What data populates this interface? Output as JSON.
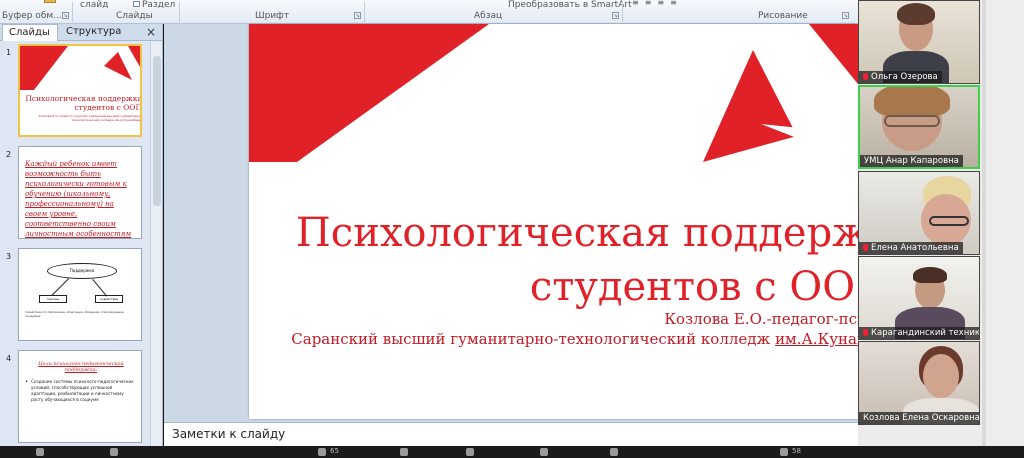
{
  "ribbon": {
    "top_items": [
      "слайд",
      "Раздел",
      "Преобразовать в SmartArt"
    ],
    "groups": [
      "Буфер обм...",
      "Слайды",
      "Шрифт",
      "Абзац",
      "Рисование"
    ]
  },
  "left_pane": {
    "tabs": [
      "Слайды",
      "Структура"
    ],
    "close": "×",
    "thumbnails": [
      {
        "number": "1",
        "title": "Психологическая поддержка студентов с ООП",
        "subtitle": "Козлова Е.О.-педагог-психолог Саранский высший гуманитарно-технологический колледж им.А.Кунанбаева"
      },
      {
        "number": "2",
        "text": "Каждый ребенок имеет возможность быть психологически готовым к обучению (школьному, профессиональному) на своем уровне, соответственно своим личностным особенностям"
      },
      {
        "number": "3",
        "ellipse": "Поддержка",
        "boxes": [
          "помощь",
          "содействие"
        ],
        "text": "Содействие это обеспечение, облегчение, ободрение, стимулирование, поощрение"
      },
      {
        "number": "4",
        "heading": "Цели психолого-педагогической поддержки:",
        "bullet": "•",
        "body": "Создание системы психолого-педагогических условий, способствующих успешной адаптации, реабилитации и личностному росту обучающихся в социуме"
      }
    ]
  },
  "slide": {
    "title_line1": "Психологическая поддерж",
    "title_line2": "студентов с ОО",
    "author": "Козлова Е.О.-педагог-пси",
    "college_prefix": "Саранский высший гуманитарно-технологический колледж ",
    "college_suffix": "им.А.Кунан"
  },
  "notes": {
    "label": "Заметки к слайду"
  },
  "participants": [
    {
      "name": "Ольга Озерова",
      "speaking": false
    },
    {
      "name": "УМЦ Анар Капаровна",
      "speaking": true
    },
    {
      "name": "Елена Анатольевна",
      "speaking": false
    },
    {
      "name": "Карагандинский технико-стр...",
      "speaking": false
    },
    {
      "name": "Козлова Елена Оскаровна",
      "speaking": false
    }
  ],
  "bottom_bar": {
    "participants_count": "65",
    "other": "58"
  },
  "colors": {
    "accent_red": "#e02128",
    "slide_red": "#c41a23",
    "speaking_green": "#3fcf4a"
  }
}
